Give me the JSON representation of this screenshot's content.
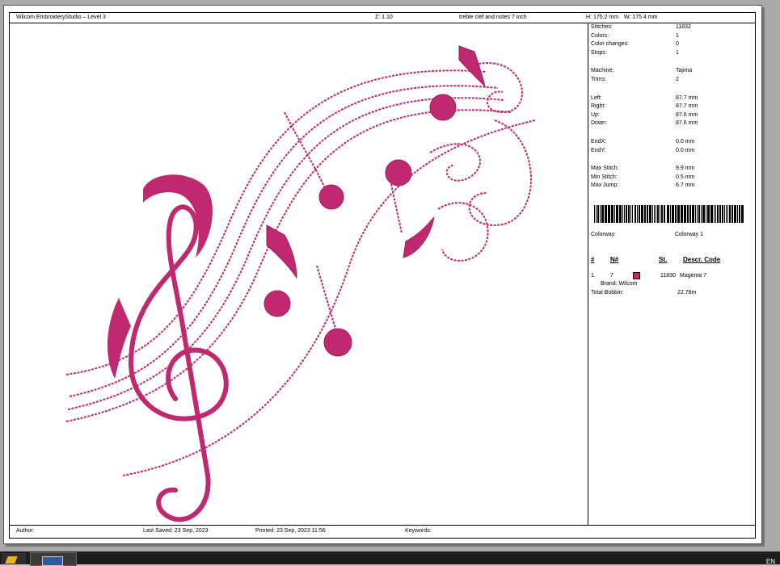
{
  "header": {
    "app_title": "Wilcom EmbroideryStudio – Level 3",
    "zoom": "Z: 1.10",
    "design_name": "treble clef and notes 7 inch",
    "height_label": "H: 175.2 mm",
    "width_label": "W: 175.4 mm"
  },
  "stats": [
    {
      "label": "Stitches:",
      "value": "11832"
    },
    {
      "label": "Colors:",
      "value": "1"
    },
    {
      "label": "Color changes:",
      "value": "0"
    },
    {
      "label": "Stops:",
      "value": "1"
    },
    {
      "label": "Machine:",
      "value": "Tajima"
    },
    {
      "label": "Trims:",
      "value": "2"
    },
    {
      "label": "Left:",
      "value": "87.7 mm"
    },
    {
      "label": "Right:",
      "value": "87.7 mm"
    },
    {
      "label": "Up:",
      "value": "87.6 mm"
    },
    {
      "label": "Down:",
      "value": "87.6 mm"
    },
    {
      "label": "EndX:",
      "value": "0.0 mm"
    },
    {
      "label": "EndY:",
      "value": "0.0 mm"
    },
    {
      "label": "Max Stitch:",
      "value": "9.9 mm"
    },
    {
      "label": "Min Stitch:",
      "value": "0.5 mm"
    },
    {
      "label": "Max Jump:",
      "value": "6.7 mm"
    }
  ],
  "colorway": {
    "label": "Colorway:",
    "value": "Colorway 1"
  },
  "color_table": {
    "headers": [
      "#",
      "N#",
      "St.",
      "Descr. Code"
    ],
    "rows": [
      {
        "index": "1.",
        "number": "7",
        "stitches": "11830",
        "description": "Magenta 7",
        "brand": "Brand: Wilcom",
        "color": "#c0296f"
      }
    ]
  },
  "total_bobbin": {
    "label": "Total Bobbin:",
    "value": "22.78m"
  },
  "footer": {
    "author": "Author:",
    "last_saved": "Last Saved: 23 Sep, 2023",
    "printed": "Printed: 23 Sep, 2023 11:56",
    "keywords": "Keywords:"
  },
  "taskbar": {
    "language": "EN"
  },
  "colors": {
    "thread": "#c0296f",
    "thread_dark": "#9e1f5a",
    "paper": "#ffffff",
    "backdrop": "#a9a9a9"
  },
  "icons": {
    "start": "windows-start-icon",
    "task": "embroidery-studio-window-icon"
  }
}
